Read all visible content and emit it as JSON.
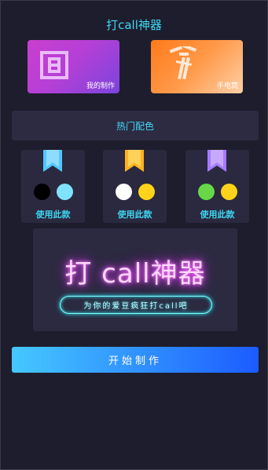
{
  "header": {
    "title": "打call神器"
  },
  "cards": [
    {
      "label": "我的制作",
      "icon": "grid-pattern-icon"
    },
    {
      "label": "手电筒",
      "icon": "flashlight-icon"
    }
  ],
  "section": {
    "title": "热门配色"
  },
  "palettes": [
    {
      "ribbon_color": "#52c7ff",
      "colors": [
        "#000000",
        "#7fe3ff"
      ],
      "button": "使用此款"
    },
    {
      "ribbon_color": "#ffb21f",
      "colors": [
        "#ffffff",
        "#ffd319"
      ],
      "button": "使用此款"
    },
    {
      "ribbon_color": "#a57cff",
      "colors": [
        "#66d847",
        "#ffd319"
      ],
      "button": "使用此款"
    }
  ],
  "preview": {
    "title": "打 call神器",
    "subtitle": "为你的爱豆疯狂打call吧"
  },
  "actions": {
    "start_label": "开始制作"
  },
  "colors": {
    "background": "#1e1d2d",
    "accent": "#3fd7f2",
    "neon_pink": "#e040fb",
    "neon_cyan": "#2fe6f0"
  }
}
